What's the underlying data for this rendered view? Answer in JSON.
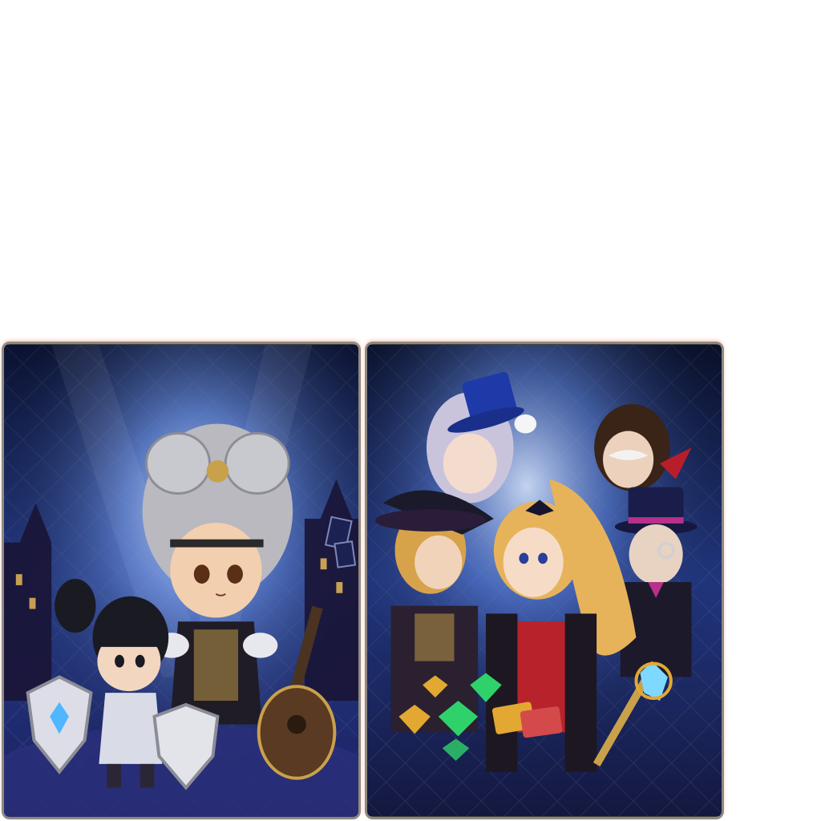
{
  "cards": [
    {
      "id": "left",
      "subject": "chibi-warriors",
      "colors": {
        "sky_top": "#101a3a",
        "sky_mid": "#2a3f8c",
        "glow": "#9fc6ff",
        "floor": "#1a1f52",
        "hair_silver": "#b9b9bf",
        "hair_black": "#1a1a22",
        "gold": "#c9a14a",
        "crystal": "#4fb6ff"
      }
    },
    {
      "id": "right",
      "subject": "masquerade-heroes",
      "colors": {
        "sky_top": "#0c1333",
        "sky_mid": "#233a86",
        "glow": "#a8c9ff",
        "hat_blue": "#1e3aa8",
        "hair_blonde": "#e7b35a",
        "dress_red": "#b8232b",
        "gem_green": "#2fd26a",
        "gem_gold": "#e2a832",
        "ticket_red": "#d44a4a"
      }
    }
  ]
}
